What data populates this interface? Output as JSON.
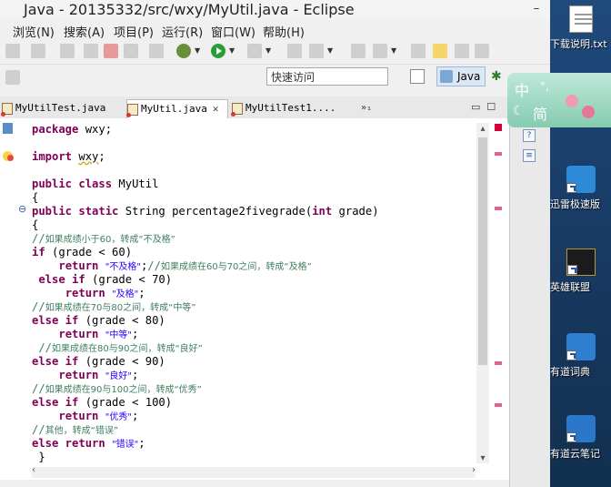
{
  "window": {
    "title": "Java - 20135332/src/wxy/MyUtil.java - Eclipse",
    "controls": [
      "–",
      "□",
      "✕"
    ]
  },
  "menu": [
    "浏览(N)",
    "搜索(A)",
    "项目(P)",
    "运行(R)",
    "窗口(W)",
    "帮助(H)"
  ],
  "quick_access": {
    "value": "快速访问"
  },
  "perspective": {
    "java_label": "Java"
  },
  "tabs": [
    {
      "label": "MyUtilTest.java",
      "active": false
    },
    {
      "label": "MyUtil.java",
      "active": true,
      "close": "✕"
    },
    {
      "label": "MyUtilTest1....",
      "active": false
    }
  ],
  "tabs_overflow": "»₁",
  "code_lines": [
    [
      {
        "t": "k",
        "v": "package"
      },
      {
        "t": "p",
        "v": " wxy;"
      }
    ],
    [],
    [
      {
        "t": "k",
        "v": "import"
      },
      {
        "t": "p",
        "v": " "
      },
      {
        "t": "u",
        "v": "wxy"
      },
      {
        "t": "p",
        "v": ";"
      }
    ],
    [],
    [
      {
        "t": "k",
        "v": "public class"
      },
      {
        "t": "p",
        "v": " MyUtil"
      }
    ],
    [
      {
        "t": "p",
        "v": "{"
      }
    ],
    [
      {
        "t": "k",
        "v": "public static"
      },
      {
        "t": "p",
        "v": " String percentage2fivegrade("
      },
      {
        "t": "k",
        "v": "int"
      },
      {
        "t": "p",
        "v": " grade)"
      }
    ],
    [
      {
        "t": "p",
        "v": "{"
      }
    ],
    [
      {
        "t": "cm",
        "v": "//"
      },
      {
        "t": "c",
        "v": "如果成绩小于60，转成“不及格”"
      }
    ],
    [
      {
        "t": "k",
        "v": "if"
      },
      {
        "t": "p",
        "v": " (grade < 60)"
      }
    ],
    [
      {
        "t": "p",
        "v": "    "
      },
      {
        "t": "k",
        "v": "return"
      },
      {
        "t": "p",
        "v": " "
      },
      {
        "t": "s",
        "v": "\"不及格\""
      },
      {
        "t": "p",
        "v": ";"
      },
      {
        "t": "cm",
        "v": "//"
      },
      {
        "t": "c",
        "v": "如果成绩在60与70之间，转成“及格”"
      }
    ],
    [
      {
        "t": "p",
        "v": " "
      },
      {
        "t": "k",
        "v": "else if"
      },
      {
        "t": "p",
        "v": " (grade < 70)"
      }
    ],
    [
      {
        "t": "p",
        "v": "     "
      },
      {
        "t": "k",
        "v": "return"
      },
      {
        "t": "p",
        "v": " "
      },
      {
        "t": "s",
        "v": "\"及格\""
      },
      {
        "t": "p",
        "v": ";"
      }
    ],
    [
      {
        "t": "cm",
        "v": "//"
      },
      {
        "t": "c",
        "v": "如果成绩在70与80之间，转成“中等”"
      }
    ],
    [
      {
        "t": "k",
        "v": "else if"
      },
      {
        "t": "p",
        "v": " (grade < 80)"
      }
    ],
    [
      {
        "t": "p",
        "v": "    "
      },
      {
        "t": "k",
        "v": "return"
      },
      {
        "t": "p",
        "v": " "
      },
      {
        "t": "s",
        "v": "\"中等\""
      },
      {
        "t": "p",
        "v": ";"
      }
    ],
    [
      {
        "t": "p",
        "v": " "
      },
      {
        "t": "cm",
        "v": "//"
      },
      {
        "t": "c",
        "v": "如果成绩在80与90之间，转成“良好”"
      }
    ],
    [
      {
        "t": "k",
        "v": "else if"
      },
      {
        "t": "p",
        "v": " (grade < 90)"
      }
    ],
    [
      {
        "t": "p",
        "v": "    "
      },
      {
        "t": "k",
        "v": "return"
      },
      {
        "t": "p",
        "v": " "
      },
      {
        "t": "s",
        "v": "\"良好\""
      },
      {
        "t": "p",
        "v": ";"
      }
    ],
    [
      {
        "t": "cm",
        "v": "//"
      },
      {
        "t": "c",
        "v": "如果成绩在90与100之间，转成“优秀”"
      }
    ],
    [
      {
        "t": "k",
        "v": "else if"
      },
      {
        "t": "p",
        "v": " (grade < 100)"
      }
    ],
    [
      {
        "t": "p",
        "v": "    "
      },
      {
        "t": "k",
        "v": "return"
      },
      {
        "t": "p",
        "v": " "
      },
      {
        "t": "s",
        "v": "\"优秀\""
      },
      {
        "t": "p",
        "v": ";"
      }
    ],
    [
      {
        "t": "cm",
        "v": "//"
      },
      {
        "t": "c",
        "v": "其他，转成“错误”"
      }
    ],
    [
      {
        "t": "k",
        "v": "else return"
      },
      {
        "t": "p",
        "v": " "
      },
      {
        "t": "s",
        "v": "\"错误\""
      },
      {
        "t": "p",
        "v": ";"
      }
    ],
    [
      {
        "t": "p",
        "v": " }"
      }
    ]
  ],
  "ime": {
    "zh": "中",
    "jian": "简",
    "moon": "☾",
    "dot": "°,"
  },
  "desktop_icons": [
    {
      "label": "下载说明.txt",
      "icon": "text-file-icon"
    },
    {
      "label": "迅雷极速版",
      "icon": "xunlei-icon"
    },
    {
      "label": "英雄联盟",
      "icon": "lol-icon"
    },
    {
      "label": "有道词典",
      "icon": "youdao-dict-icon"
    },
    {
      "label": "有道云笔记",
      "icon": "youdao-note-icon"
    }
  ]
}
